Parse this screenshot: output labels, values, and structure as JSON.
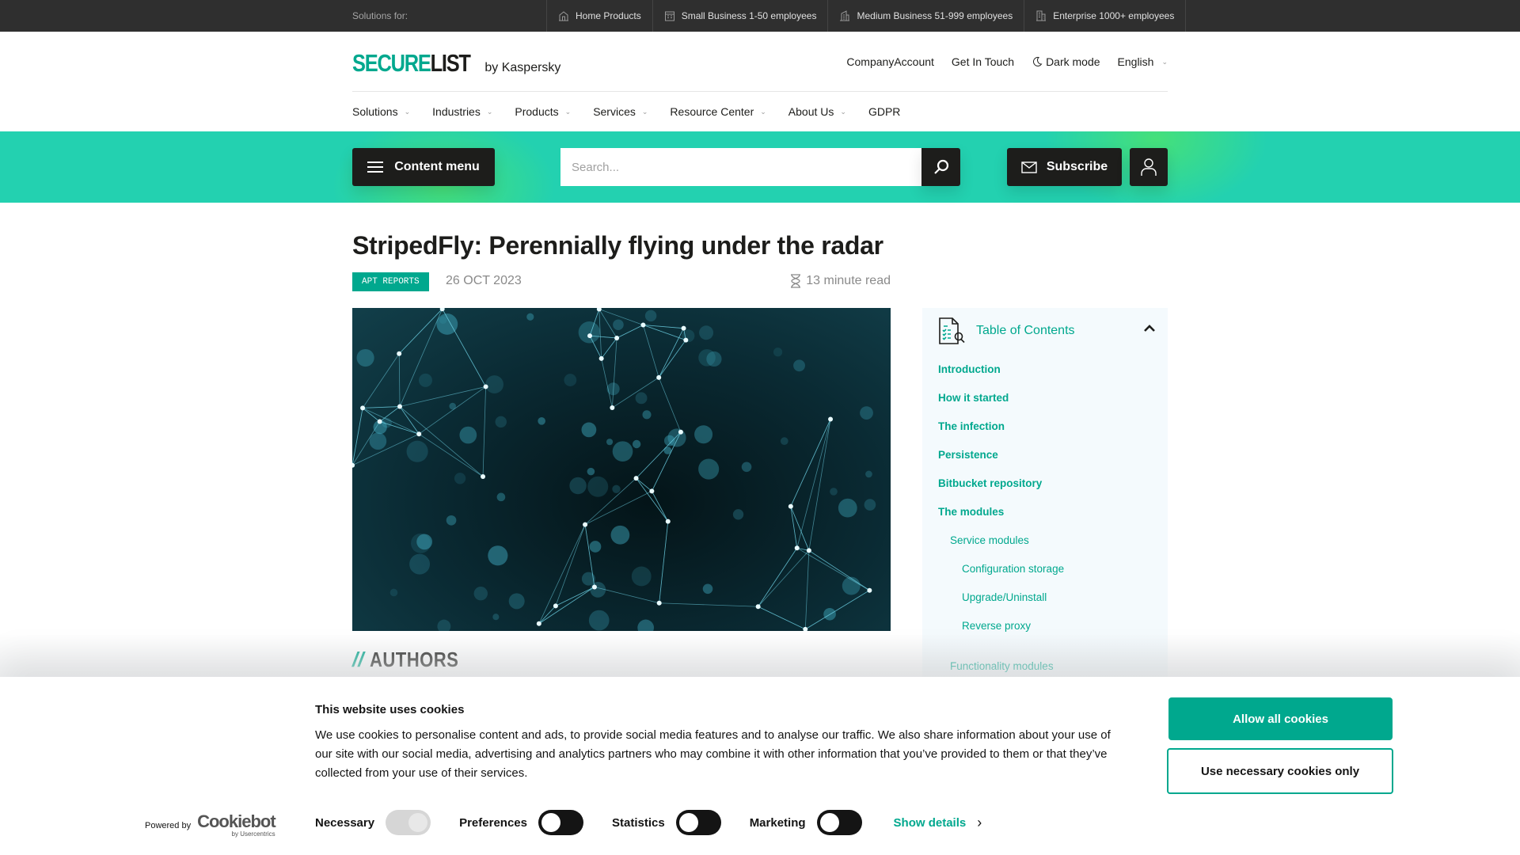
{
  "topbar": {
    "label": "Solutions for:",
    "segments": [
      {
        "label": "Home Products",
        "icon": "house-icon"
      },
      {
        "label": "Small Business 1-50 employees",
        "icon": "small-building-icon"
      },
      {
        "label": "Medium Business 51-999 employees",
        "icon": "medium-building-icon"
      },
      {
        "label": "Enterprise 1000+ employees",
        "icon": "enterprise-building-icon"
      }
    ]
  },
  "header": {
    "logo_secure": "SECURE",
    "logo_list": "LIST",
    "logo_by": "by Kaspersky",
    "links": {
      "company_account": "CompanyAccount",
      "get_in_touch": "Get In Touch",
      "dark_mode": "Dark mode",
      "language": "English"
    }
  },
  "nav": {
    "items": [
      {
        "label": "Solutions",
        "dropdown": true
      },
      {
        "label": "Industries",
        "dropdown": true
      },
      {
        "label": "Products",
        "dropdown": true
      },
      {
        "label": "Services",
        "dropdown": true
      },
      {
        "label": "Resource Center",
        "dropdown": true
      },
      {
        "label": "About Us",
        "dropdown": true
      },
      {
        "label": "GDPR",
        "dropdown": false
      }
    ]
  },
  "band": {
    "content_menu": "Content menu",
    "search_placeholder": "Search...",
    "subscribe": "Subscribe"
  },
  "article": {
    "title": "StripedFly: Perennially flying under the radar",
    "tag": "APT REPORTS",
    "date": "26 OCT 2023",
    "read_time": "13 minute read",
    "authors_prefix": "//",
    "authors_heading": "AUTHORS"
  },
  "toc": {
    "title": "Table of Contents",
    "items": [
      {
        "label": "Introduction",
        "level": 1
      },
      {
        "label": "How it started",
        "level": 1
      },
      {
        "label": "The infection",
        "level": 1
      },
      {
        "label": "Persistence",
        "level": 1
      },
      {
        "label": "Bitbucket repository",
        "level": 1
      },
      {
        "label": "The modules",
        "level": 1
      },
      {
        "label": "Service modules",
        "level": 2
      },
      {
        "label": "Configuration storage",
        "level": 3
      },
      {
        "label": "Upgrade/Uninstall",
        "level": 3
      },
      {
        "label": "Reverse proxy",
        "level": 3
      },
      {
        "label": "Functionality modules",
        "level": 2
      }
    ]
  },
  "cookie": {
    "title": "This website uses cookies",
    "text": "We use cookies to personalise content and ads, to provide social media features and to analyse our traffic. We also share information about your use of our site with our social media, advertising and analytics partners who may combine it with other information that you’ve provided to them or that they’ve collected from your use of their services.",
    "powered_by": "Powered by",
    "brand": "Cookiebot",
    "brand_sub": "by Usercentrics",
    "toggles": [
      {
        "label": "Necessary",
        "state": "on-disabled"
      },
      {
        "label": "Preferences",
        "state": "off"
      },
      {
        "label": "Statistics",
        "state": "off"
      },
      {
        "label": "Marketing",
        "state": "off"
      }
    ],
    "show_details": "Show details",
    "allow_all": "Allow all cookies",
    "necessary_only": "Use necessary cookies only"
  },
  "colors": {
    "accent": "#00a88e",
    "band": "#23d1b0",
    "dark": "#1d1d1b",
    "topbar": "#2f2f2f"
  }
}
